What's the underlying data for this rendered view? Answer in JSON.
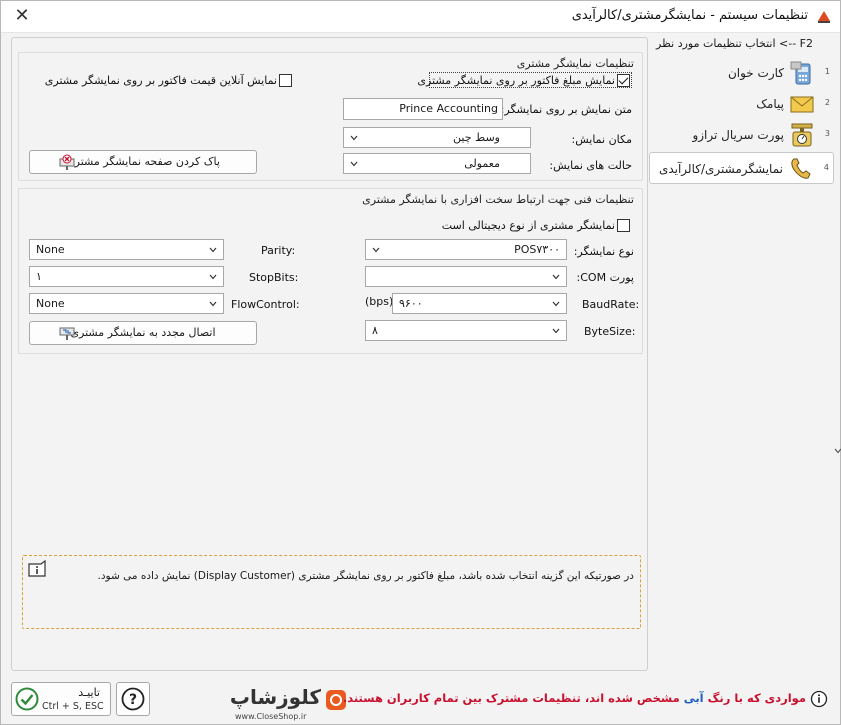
{
  "window": {
    "title": "تنظیمات سیستم - نمایشگرمشتری/کالرآیدی"
  },
  "nav": {
    "header": "F2 --> انتخاب تنظیمات مورد نظر",
    "items": [
      {
        "num": "1",
        "label": "کارت خوان",
        "icon": "card-reader-icon"
      },
      {
        "num": "2",
        "label": "پیامک",
        "icon": "envelope-icon"
      },
      {
        "num": "3",
        "label": "پورت سریال ترازو",
        "icon": "scale-icon"
      },
      {
        "num": "4",
        "label": "نمایشگرمشتری/کالرآیدی",
        "icon": "phone-icon",
        "selected": true
      }
    ]
  },
  "display_settings": {
    "title": "تنظیمات نمایشگر مشتری",
    "show_invoice_amount_label": "نمایش مبلغ فاکتور بر روی نمایشگر مشتری",
    "show_invoice_amount_checked": true,
    "show_online_price_label": "نمایش آنلاین قیمت فاکتور بر روی نمایشگر مشتری",
    "show_online_price_checked": false,
    "display_text_label": "متن نمایش بر روی نمایشگر:",
    "display_text_value": "Prince Accounting",
    "position_label": "مکان نمایش:",
    "position_value": "وسط چین",
    "mode_label": "حالت های نمایش:",
    "mode_value": "معمولی",
    "clear_button": "پاک کردن صفحه نمایشگر مشتری"
  },
  "hardware_settings": {
    "title": "تنظیمات فنی جهت ارتباط سخت افزاری با نمایشگر مشتری",
    "digital_label": "نمایشگر مشتری از نوع دیجیتالی است",
    "digital_checked": false,
    "display_type_label": "نوع نمایشگر:",
    "display_type_value": "POS۷۳۰۰",
    "com_port_label": "پورت COM:",
    "com_port_value": "",
    "baudrate_label": "BaudRate:",
    "baudrate_unit": "(bps)",
    "baudrate_value": "۹۶۰۰",
    "bytesize_label": "ByteSize:",
    "bytesize_value": "۸",
    "parity_label": "Parity:",
    "parity_value": "None",
    "stopbits_label": "StopBits:",
    "stopbits_value": "۱",
    "flowcontrol_label": "FlowControl:",
    "flowcontrol_value": "None",
    "reconnect_button": "اتصال مجدد به نمایشگر مشتری"
  },
  "info": {
    "text": "در صورتیکه این گزینه انتخاب شده باشد، مبلغ فاکتور بر روی نمایشگر مشتری (Display Customer) نمایش داده می شود."
  },
  "footer": {
    "confirm_label": "تاییـد",
    "confirm_shortcut": "Ctrl + S, ESC",
    "note_prefix": "مواردی که با رنگ",
    "note_blue": "آبی",
    "note_suffix": "مشخص شده اند، تنظیمات مشترک بین تمام کاربران هستند.",
    "watermark_text": "کلوزشاپ",
    "watermark_url": "www.CloseShop.ir"
  },
  "colors": {
    "note_red": "#c8102e",
    "note_blue": "#1f5fbf",
    "info_border": "#d8a23a",
    "confirm_green": "#2e8b3a"
  }
}
